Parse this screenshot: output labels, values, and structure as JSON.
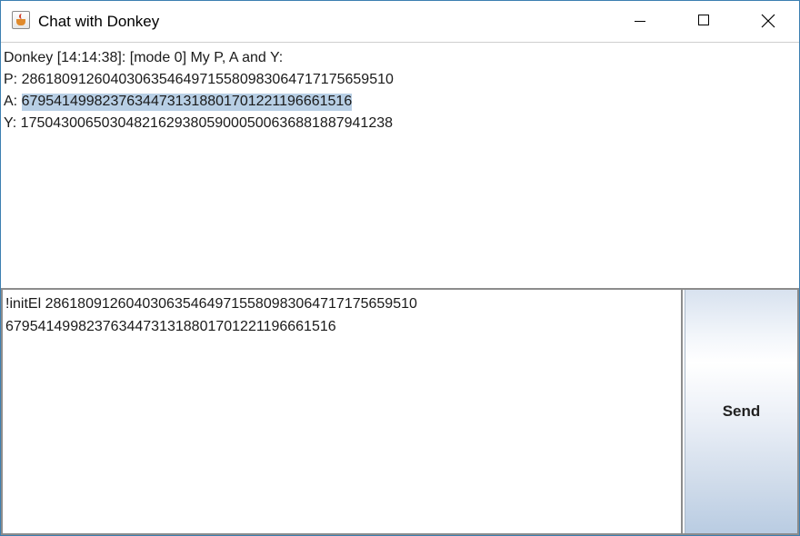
{
  "window": {
    "title": "Chat with Donkey",
    "app_icon": "java-cup-icon",
    "controls": {
      "minimize_icon": "minimize-icon",
      "maximize_icon": "maximize-icon",
      "close_icon": "close-icon"
    }
  },
  "chat_log": {
    "lines": [
      {
        "text": "Donkey [14:14:38]: [mode 0] My P, A and Y:"
      },
      {
        "text": "P: 2861809126040306354649715580983064717175659510"
      },
      {
        "prefix": "A: ",
        "selected_text": "67954149982376344731318801701221196661516"
      },
      {
        "text": "Y: 1750430065030482162938059000500636881887941238"
      }
    ],
    "selection_color": "#b8cfe5"
  },
  "message_input": {
    "lines": [
      "!initEl 2861809126040306354649715580983064717175659510",
      "67954149982376344731318801701221196661516"
    ]
  },
  "send_button": {
    "label": "Send"
  }
}
